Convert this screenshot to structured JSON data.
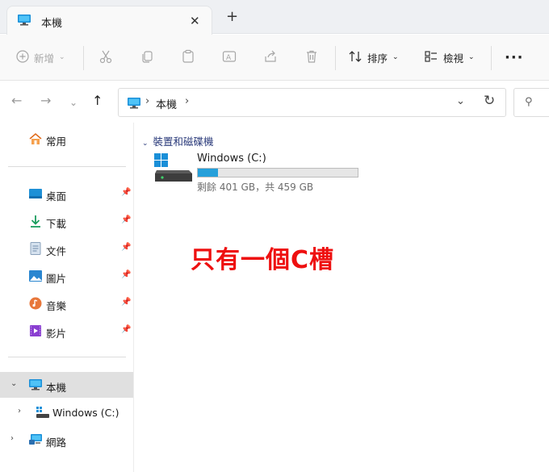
{
  "window": {
    "tab_title": "本機"
  },
  "toolbar": {
    "new_label": "新增",
    "sort_label": "排序",
    "view_label": "檢視"
  },
  "address": {
    "location": "本機"
  },
  "sidebar": {
    "home": "常用",
    "quick_access": [
      {
        "label": "桌面",
        "icon": "desktop-icon"
      },
      {
        "label": "下載",
        "icon": "download-icon"
      },
      {
        "label": "文件",
        "icon": "document-icon"
      },
      {
        "label": "圖片",
        "icon": "picture-icon"
      },
      {
        "label": "音樂",
        "icon": "music-icon"
      },
      {
        "label": "影片",
        "icon": "video-icon"
      }
    ],
    "this_pc": "本機",
    "drive": "Windows (C:)",
    "network": "網路"
  },
  "content": {
    "group_label": "裝置和磁碟機",
    "drive_name": "Windows (C:)",
    "drive_space": "剩餘 401 GB，共 459 GB",
    "drive_used_fraction": 0.126,
    "annotation": "只有一個C槽"
  },
  "colors": {
    "accent": "#26a0da",
    "annotation": "#ee1010",
    "selected": "#e0e0e0"
  }
}
